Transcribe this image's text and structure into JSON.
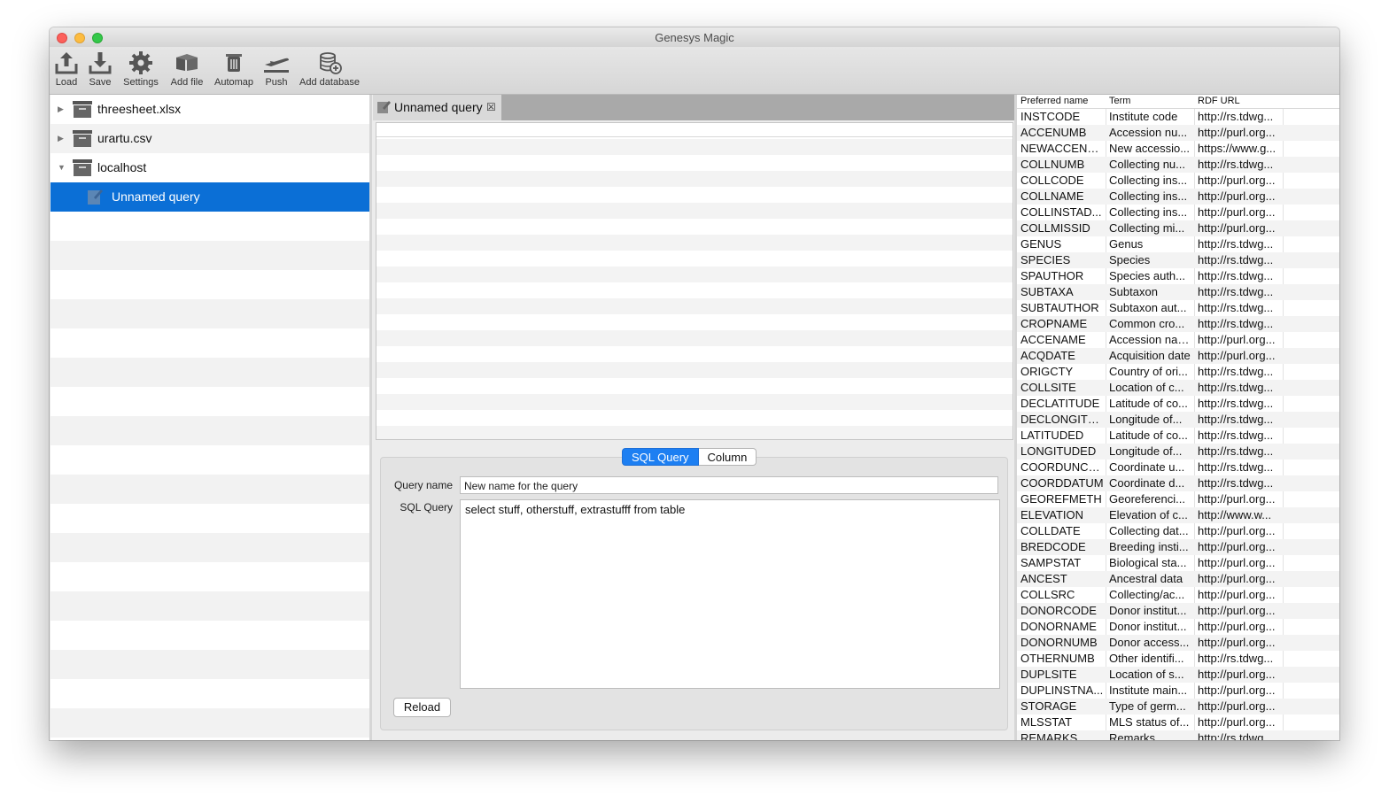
{
  "window": {
    "title": "Genesys Magic"
  },
  "toolbar": {
    "buttons": [
      {
        "label": "Load",
        "icon": "upload-icon"
      },
      {
        "label": "Save",
        "icon": "download-icon"
      },
      {
        "label": "Settings",
        "icon": "gear-icon"
      },
      {
        "label": "Add file",
        "icon": "boxes-icon"
      },
      {
        "label": "Automap",
        "icon": "trash-icon"
      },
      {
        "label": "Push",
        "icon": "airplane-icon"
      },
      {
        "label": "Add database",
        "icon": "database-add-icon"
      }
    ]
  },
  "sidebar": {
    "items": [
      {
        "label": "threesheet.xlsx",
        "expanded": false
      },
      {
        "label": "urartu.csv",
        "expanded": false
      },
      {
        "label": "localhost",
        "expanded": true
      },
      {
        "label": "Unnamed query",
        "selected": true
      }
    ]
  },
  "editor": {
    "tab_label": "Unnamed query",
    "segments": [
      "SQL Query",
      "Column"
    ],
    "query_name_label": "Query name",
    "query_name_value": "New name for the query",
    "sql_label": "SQL Query",
    "sql_value": "select stuff, otherstuff, extrastufff from table",
    "reload_label": "Reload"
  },
  "terms_table": {
    "columns": [
      "Preferred name",
      "Term",
      "RDF URL"
    ],
    "rows": [
      [
        "INSTCODE",
        "Institute code",
        "http://rs.tdwg..."
      ],
      [
        "ACCENUMB",
        "Accession nu...",
        "http://purl.org..."
      ],
      [
        "NEWACCENU...",
        "New accessio...",
        "https://www.g..."
      ],
      [
        "COLLNUMB",
        "Collecting nu...",
        "http://rs.tdwg..."
      ],
      [
        "COLLCODE",
        "Collecting ins...",
        "http://purl.org..."
      ],
      [
        "COLLNAME",
        "Collecting ins...",
        "http://purl.org..."
      ],
      [
        "COLLINSTAD...",
        "Collecting ins...",
        "http://purl.org..."
      ],
      [
        "COLLMISSID",
        "Collecting mi...",
        "http://purl.org..."
      ],
      [
        "GENUS",
        "Genus",
        "http://rs.tdwg..."
      ],
      [
        "SPECIES",
        "Species",
        "http://rs.tdwg..."
      ],
      [
        "SPAUTHOR",
        "Species auth...",
        "http://rs.tdwg..."
      ],
      [
        "SUBTAXA",
        "Subtaxon",
        "http://rs.tdwg..."
      ],
      [
        "SUBTAUTHOR",
        "Subtaxon aut...",
        "http://rs.tdwg..."
      ],
      [
        "CROPNAME",
        "Common cro...",
        "http://rs.tdwg..."
      ],
      [
        "ACCENAME",
        "Accession name",
        "http://purl.org..."
      ],
      [
        "ACQDATE",
        "Acquisition date",
        "http://purl.org..."
      ],
      [
        "ORIGCTY",
        "Country of ori...",
        "http://rs.tdwg..."
      ],
      [
        "COLLSITE",
        "Location of c...",
        "http://rs.tdwg..."
      ],
      [
        "DECLATITUDE",
        "Latitude of co...",
        "http://rs.tdwg..."
      ],
      [
        "DECLONGITU...",
        "Longitude of...",
        "http://rs.tdwg..."
      ],
      [
        "LATITUDED",
        "Latitude of co...",
        "http://rs.tdwg..."
      ],
      [
        "LONGITUDED",
        "Longitude of...",
        "http://rs.tdwg..."
      ],
      [
        "COORDUNCERT",
        "Coordinate u...",
        "http://rs.tdwg..."
      ],
      [
        "COORDDATUM",
        "Coordinate d...",
        "http://rs.tdwg..."
      ],
      [
        "GEOREFMETH",
        "Georeferenci...",
        "http://purl.org..."
      ],
      [
        "ELEVATION",
        "Elevation of c...",
        "http://www.w..."
      ],
      [
        "COLLDATE",
        "Collecting dat...",
        "http://purl.org..."
      ],
      [
        "BREDCODE",
        "Breeding insti...",
        "http://purl.org..."
      ],
      [
        "SAMPSTAT",
        "Biological sta...",
        "http://purl.org..."
      ],
      [
        "ANCEST",
        "Ancestral data",
        "http://purl.org..."
      ],
      [
        "COLLSRC",
        "Collecting/ac...",
        "http://purl.org..."
      ],
      [
        "DONORCODE",
        "Donor institut...",
        "http://purl.org..."
      ],
      [
        "DONORNAME",
        "Donor institut...",
        "http://purl.org..."
      ],
      [
        "DONORNUMB",
        "Donor access...",
        "http://purl.org..."
      ],
      [
        "OTHERNUMB",
        "Other identifi...",
        "http://rs.tdwg..."
      ],
      [
        "DUPLSITE",
        "Location of s...",
        "http://purl.org..."
      ],
      [
        "DUPLINSTNA...",
        "Institute main...",
        "http://purl.org..."
      ],
      [
        "STORAGE",
        "Type of germ...",
        "http://purl.org..."
      ],
      [
        "MLSSTAT",
        "MLS status of...",
        "http://purl.org..."
      ],
      [
        "REMARKS",
        "Remarks",
        "http://rs.tdwg..."
      ]
    ]
  },
  "colors": {
    "selection": "#0b6fd6",
    "segment_active": "#1d7ff2"
  }
}
